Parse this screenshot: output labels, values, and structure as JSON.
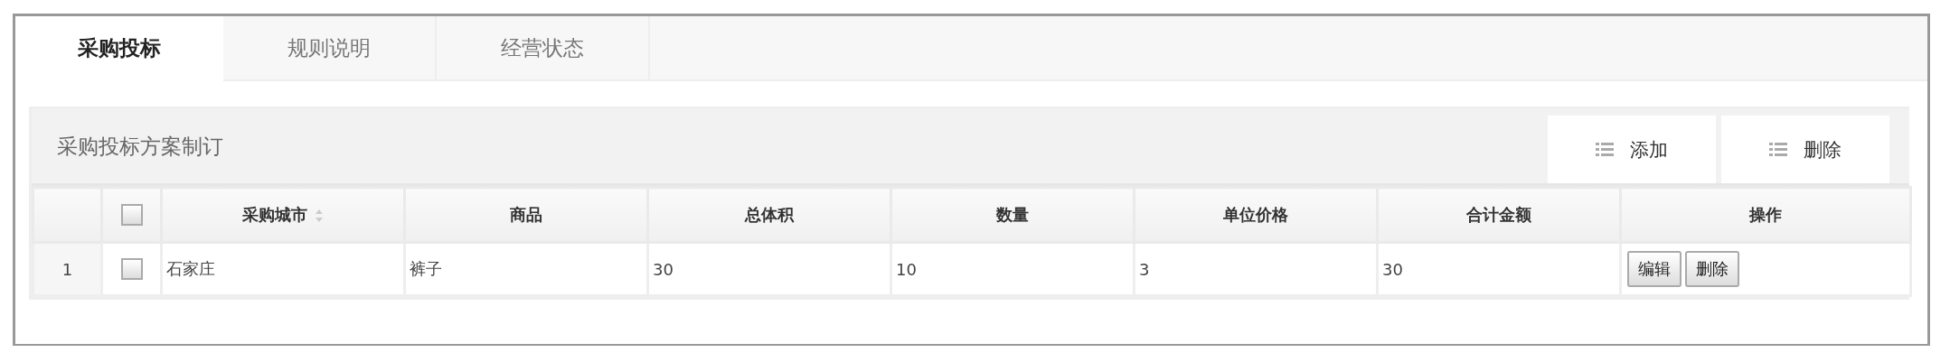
{
  "tabs": [
    {
      "label": "采购投标",
      "selected": true
    },
    {
      "label": "规则说明",
      "selected": false
    },
    {
      "label": "经营状态",
      "selected": false
    }
  ],
  "panel": {
    "title": "采购投标方案制订",
    "toolbar": [
      {
        "label": "添加"
      },
      {
        "label": "删除"
      }
    ]
  },
  "table": {
    "columns": [
      {
        "label": "采购城市",
        "sortable": true
      },
      {
        "label": "商品",
        "sortable": false
      },
      {
        "label": "总体积",
        "sortable": false
      },
      {
        "label": "数量",
        "sortable": false
      },
      {
        "label": "单位价格",
        "sortable": false
      },
      {
        "label": "合计金额",
        "sortable": false
      },
      {
        "label": "操作",
        "sortable": false
      }
    ],
    "header_checked": false,
    "rows": [
      {
        "number": "1",
        "checked": false,
        "cells": [
          "石家庄",
          "裤子",
          "30",
          "10",
          "3",
          "30"
        ],
        "actions": [
          "编辑",
          "删除"
        ]
      }
    ]
  }
}
